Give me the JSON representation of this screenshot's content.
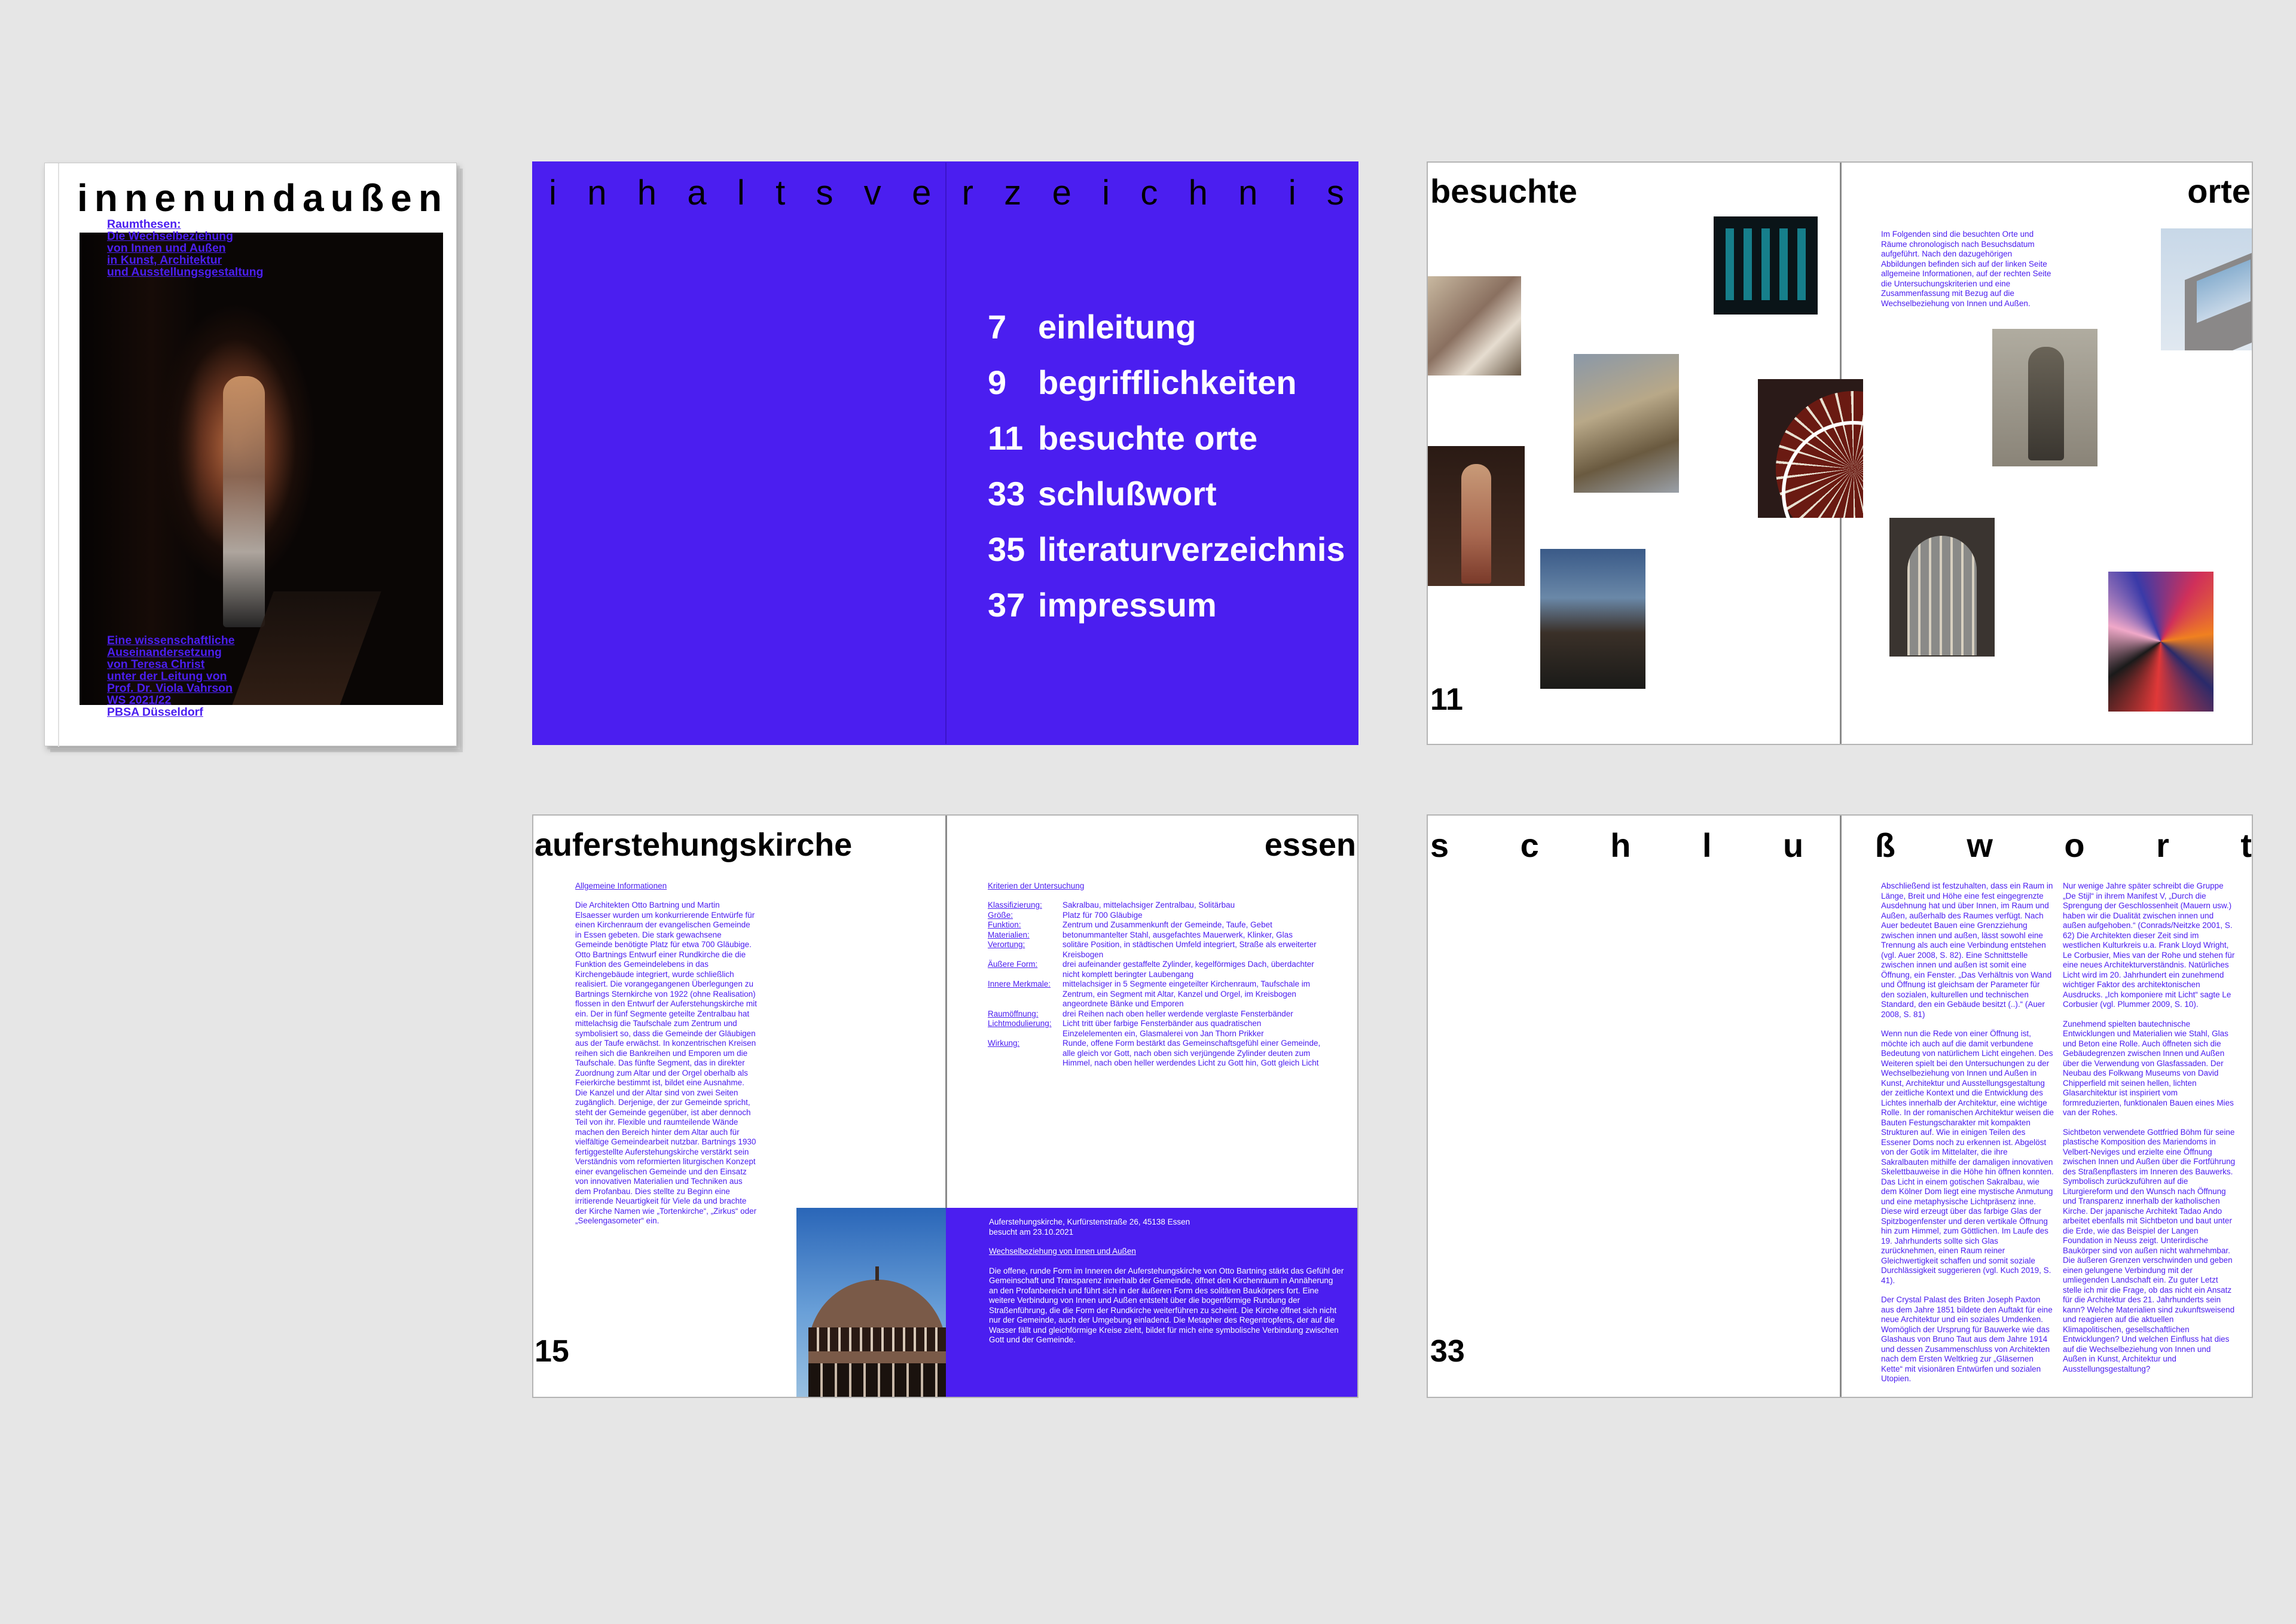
{
  "cover": {
    "title_letters": [
      "i",
      "n",
      "n",
      "e",
      "n",
      "u",
      "n",
      "d",
      "a",
      "u",
      "ß",
      "e",
      "n"
    ],
    "subtitle_lines": [
      "Raumthesen:",
      "Die Wechselbeziehung",
      "von Innen und Außen",
      "in Kunst, Architektur",
      "und Ausstellungsgestaltung"
    ],
    "credit_lines": [
      "Eine wissenschaftliche",
      "Auseinandersetzung",
      "von Teresa Christ",
      "unter der Leitung von",
      "Prof. Dr. Viola Vahrson",
      "WS 2021/22",
      "PBSA Düsseldorf"
    ]
  },
  "toc": {
    "heading_letters": [
      "i",
      "n",
      "h",
      "a",
      "l",
      "t",
      "s",
      "v",
      "e",
      "r",
      "z",
      "e",
      "i",
      "c",
      "h",
      "n",
      "i",
      "s"
    ],
    "items": [
      {
        "page": "7",
        "label": "einleitung"
      },
      {
        "page": "9",
        "label": "begrifflichkeiten"
      },
      {
        "page": "11",
        "label": "besuchte orte"
      },
      {
        "page": "33",
        "label": "schlußwort"
      },
      {
        "page": "35",
        "label": "literaturverzeichnis"
      },
      {
        "page": "37",
        "label": "impressum"
      }
    ]
  },
  "places": {
    "title_left": "besuchte",
    "title_right": "orte",
    "page_number": "11",
    "intro": "Im Folgenden sind die besuchten Orte und Räume chronologisch nach Besuchsdatum aufgeführt. Nach den dazugehörigen Abbildungen befinden sich auf der linken Seite allgemeine Informationen, auf der rechten Seite die Untersuchungskriterien und eine Zusammenfassung mit Bezug auf die Wechselbeziehung von Innen und Außen."
  },
  "church": {
    "title_left": "auferstehungskirche",
    "title_right": "essen",
    "page_number": "15",
    "general_heading": "Allgemeine Informationen",
    "general_text": "Die Architekten Otto Bartning und Martin Elsaesser wurden um konkurrierende Entwürfe für einen Kirchenraum der evangelischen Gemeinde in Essen gebeten. Die stark gewachsene Gemeinde benötigte Platz für etwa 700 Gläubige. Otto Bartnings Entwurf einer Rundkirche die die Funktion des Gemeindelebens in das Kirchengebäude integriert, wurde schließlich realisiert. Die vorangegangenen Überlegungen zu Bartnings Sternkirche von 1922 (ohne Realisation) flossen in den Entwurf der Auferstehungskirche mit ein. Der in fünf Segmente geteilte Zentralbau hat mittelachsig die Taufschale zum Zentrum und symbolisiert so, dass die Gemeinde der Gläubigen aus der Taufe erwächst. In konzentrischen Kreisen reihen sich die Bankreihen und Emporen um die Taufschale. Das fünfte Segment, das in direkter Zuordnung zum Altar und der Orgel oberhalb als Feierkirche bestimmt ist, bildet eine Ausnahme. Die Kanzel und der Altar sind von zwei Seiten zugänglich. Derjenige, der zur Gemeinde spricht, steht der Gemeinde gegenüber, ist aber dennoch Teil von ihr. Flexible und raumteilende Wände machen den Bereich hinter dem Altar auch für vielfältige Gemeindearbeit nutzbar. Bartnings 1930 fertiggestellte Auferstehungskirche verstärkt sein Verständnis vom reformierten liturgischen Konzept einer evangelischen Gemeinde und den Einsatz von innovativen Materialien und Techniken aus dem Profanbau. Dies stellte zu Beginn eine irritierende Neuartigkeit für Viele da und brachte der Kirche Namen wie „Tortenkirche“, „Zirkus“ oder „Seelengasometer“ ein.",
    "criteria_heading": "Kriterien der Untersuchung",
    "criteria": [
      {
        "key": "Klassifizierung:",
        "value": "Sakralbau, mittelachsiger Zentralbau, Solitärbau"
      },
      {
        "key": "Größe:",
        "value": "Platz für 700 Gläubige"
      },
      {
        "key": "Funktion:",
        "value": "Zentrum und Zusammenkunft der Gemeinde, Taufe, Gebet"
      },
      {
        "key": "Materialien:",
        "value": "betonummantelter Stahl, ausgefachtes Mauerwerk, Klinker, Glas"
      },
      {
        "key": "Verortung:",
        "value": "solitäre Position, in städtischen Umfeld integriert, Straße als erweiterter Kreisbogen"
      },
      {
        "key": "Äußere Form:",
        "value": "drei aufeinander gestaffelte Zylinder, kegelförmiges Dach, überdachter nicht komplett beringter Laubengang"
      },
      {
        "key": "Innere Merkmale:",
        "value": "mittelachsiger in 5 Segmente eingeteilter Kirchenraum, Taufschale im Zentrum, ein Segment mit Altar, Kanzel und Orgel, im Kreisbogen angeordnete Bänke und Emporen"
      },
      {
        "key": "Raumöffnung:",
        "value": "drei Reihen nach oben heller werdende verglaste Fensterbänder"
      },
      {
        "key": "Lichtmodulierung:",
        "value": "Licht tritt über farbige Fensterbänder aus quadratischen Einzelelementen ein, Glasmalerei von Jan Thorn Prikker"
      },
      {
        "key": "Wirkung:",
        "value": "Runde, offene Form bestärkt das Gemeinschaftsgefühl einer Gemeinde, alle gleich vor Gott, nach oben sich verjüngende Zylinder deuten zum Himmel, nach oben heller werdendes Licht zu Gott hin, Gott gleich Licht"
      }
    ],
    "address": "Auferstehungskirche, Kurfürstenstraße 26, 45138 Essen",
    "visited": "besucht am 23.10.2021",
    "relation_heading": "Wechselbeziehung von Innen und Außen",
    "relation_text": "Die offene, runde Form im Inneren der Auferstehungskirche von Otto Bartning stärkt das Gefühl der Gemeinschaft und Transparenz innerhalb der Gemeinde, öffnet den Kirchenraum in Annäherung an den Profanbereich und führt sich in der äußeren Form des solitären Baukörpers fort. Eine weitere Verbindung von Innen und Außen entsteht über die bogenförmige Rundung der Straßenführung, die die Form der Rundkirche weiterführen zu scheint. Die Kirche öffnet sich nicht nur der Gemeinde, auch der Umgebung einladend. Die Metapher des Regentropfens, der auf die Wasser fällt und gleichförmige Kreise zieht, bildet für mich eine symbolische Verbindung zwischen Gott und der Gemeinde."
  },
  "closing": {
    "heading_letters": [
      "s",
      "c",
      "h",
      "l",
      "u",
      "ß",
      "w",
      "o",
      "r",
      "t"
    ],
    "page_number": "33",
    "col1": [
      "Abschließend ist festzuhalten, dass ein Raum in Länge, Breit und Höhe eine fest eingegrenzte Ausdehnung hat und über Innen, im Raum und Außen, außerhalb des Raumes verfügt. Nach Auer bedeutet Bauen eine Grenzziehung zwischen innen und außen, lässt sowohl eine Trennung als auch eine Verbindung entstehen (vgl. Auer 2008, S. 82). Eine Schnittstelle zwischen innen und außen ist somit eine Öffnung, ein Fenster. „Das Verhältnis von Wand und Öffnung ist gleichsam der Parameter für den sozialen, kulturellen und technischen Standard, den ein Gebäude besitzt (..).“ (Auer 2008, S. 81)",
      "Wenn nun die Rede von einer Öffnung ist, möchte ich auch auf die damit verbundene Bedeutung von natürlichem Licht eingehen. Des Weiteren spielt bei den Untersuchungen zu der Wechselbeziehung von Innen und Außen in Kunst, Architektur und Ausstellungsgestaltung der zeitliche Kontext und die Entwicklung des Lichtes innerhalb der Architektur, eine wichtige Rolle. In der romanischen Architektur weisen die Bauten Festungscharakter mit kompakten Strukturen auf. Wie in einigen Teilen des Essener Doms noch zu erkennen ist. Abgelöst von der Gotik im Mittelalter, die ihre Sakralbauten mithilfe der damaligen innovativen Skelettbauweise in die Höhe hin öffnen konnten. Das Licht in einem gotischen Sakralbau, wie dem Kölner Dom liegt eine mystische Anmutung und eine metaphysische Lichtpräsenz inne. Diese wird erzeugt über das farbige Glas der Spitzbogenfenster und deren vertikale Öffnung hin zum Himmel, zum Göttlichen. Im Laufe des 19. Jahrhunderts sollte sich Glas zurücknehmen, einen Raum reiner Gleichwertigkeit schaffen und somit soziale Durchlässigkeit suggerieren (vgl. Kuch 2019, S. 41).",
      "Der Crystal Palast des Briten Joseph Paxton aus dem Jahre 1851 bildete den Auftakt für eine neue Architektur und ein soziales Umdenken. Womöglich der Ursprung für Bauwerke wie das Glashaus von Bruno Taut aus dem Jahre 1914 und dessen Zusammenschluss von Architekten nach dem Ersten Weltkrieg zur „Gläsernen Kette“ mit visionären Entwürfen und sozialen Utopien."
    ],
    "col2": [
      "Nur wenige Jahre später schreibt die Gruppe „De Stijl“ in ihrem Manifest V, „Durch die Sprengung der Geschlossenheit (Mauern usw.) haben wir die Dualität zwischen innen und außen aufgehoben.“ (Conrads/Neitzke 2001, S. 62) Die Architekten dieser Zeit sind im westlichen Kulturkreis u.a. Frank Lloyd Wright, Le Corbusier, Mies van der Rohe und stehen für eine neues Architekturverständnis. Natürliches Licht wird im 20. Jahrhundert ein zunehmend wichtiger Faktor des architektonischen Ausdrucks. „Ich komponiere mit Licht“ sagte Le Corbusier (vgl. Plummer 2009, S. 10).",
      "Zunehmend spielten bautechnische Entwicklungen und Materialien wie Stahl, Glas und Beton eine Rolle. Auch öffneten sich die Gebäudegrenzen zwischen Innen und Außen über die Verwendung von Glasfassaden. Der Neubau des Folkwang Museums von David Chipperfield mit seinen hellen, lichten Glasarchitektur ist inspiriert vom formreduzierten, funktionalen Bauen eines Mies van der Rohes.",
      "Sichtbeton verwendete Gottfried Böhm für seine plastische Komposition des Mariendoms in Velbert-Neviges und erzielte eine Öffnung zwischen Innen und Außen über die Fortführung des Straßenpflasters im Inneren des Bauwerks. Symbolisch zurückzuführen auf die Liturgiereform und den Wunsch nach Öffnung und Transparenz innerhalb der katholischen Kirche. Der japanische Architekt Tadao Ando arbeitet ebenfalls mit Sichtbeton und baut unter die Erde, wie das Beispiel der Langen Foundation in Neuss zeigt. Unterirdische Baukörper sind von außen nicht wahrnehmbar. Die äußeren Grenzen verschwinden und geben einen gelungene Verbindung mit der umliegenden Landschaft ein. Zu guter Letzt stelle ich mir die Frage, ob das nicht ein Ansatz für die Architektur des 21. Jahrhunderts sein kann? Welche Materialien sind zukunftsweisend und reagieren auf die aktuellen Klimapolitischen, gesellschaftlichen Entwicklungen? Und welchen Einfluss hat dies auf die Wechselbeziehung von Innen und Außen in Kunst, Architektur und Ausstellungsgestaltung?"
    ]
  },
  "colors": {
    "accent": "#4b1ef0",
    "background": "#e6e6e6",
    "paper": "#ffffff"
  }
}
